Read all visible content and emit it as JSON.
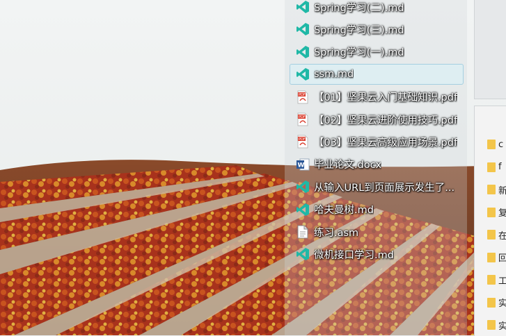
{
  "recent_files": [
    {
      "label": "Spring学习(二).md",
      "type": "vscode",
      "selected": false
    },
    {
      "label": "Spring学习(三).md",
      "type": "vscode",
      "selected": false
    },
    {
      "label": "Spring学习(一).md",
      "type": "vscode",
      "selected": false
    },
    {
      "label": "ssm.md",
      "type": "vscode",
      "selected": true
    },
    {
      "label": "【01】坚果云入门基础知识.pdf",
      "type": "pdf",
      "selected": false
    },
    {
      "label": "【02】坚果云进阶使用技巧.pdf",
      "type": "pdf",
      "selected": false
    },
    {
      "label": "【03】坚果云高级应用场景.pdf",
      "type": "pdf",
      "selected": false
    },
    {
      "label": "毕业论文.docx",
      "type": "word",
      "selected": false
    },
    {
      "label": "从输入URL到页面展示发生了...",
      "type": "vscode",
      "selected": false
    },
    {
      "label": "哈夫曼树.md",
      "type": "vscode",
      "selected": false
    },
    {
      "label": "练习.asm",
      "type": "text",
      "selected": false
    },
    {
      "label": "微机接口学习.md",
      "type": "vscode",
      "selected": false
    }
  ],
  "background_window": {
    "folders": [
      "c",
      "f",
      "新",
      "复",
      "在",
      "回",
      "工",
      "实",
      "实"
    ]
  },
  "colors": {
    "vscode_icon": "#1fb8a6",
    "pdf_icon": "#d93b2b",
    "word_icon": "#2b5797",
    "folder": "#f3c54a"
  },
  "icons": {
    "vscode": "vscode-icon",
    "pdf": "pdf-icon",
    "word": "word-document-icon",
    "text": "text-file-icon",
    "folder": "folder-icon"
  }
}
